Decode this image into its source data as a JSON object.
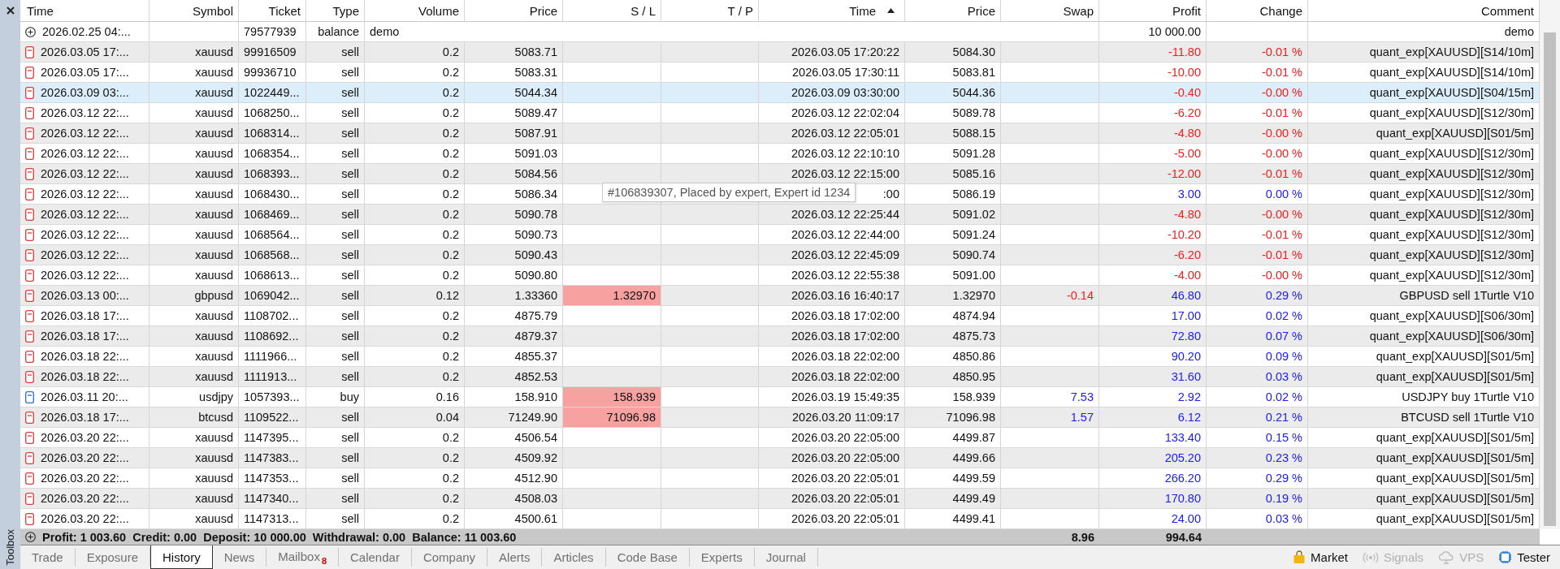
{
  "toolbox": {
    "title": "Toolbox"
  },
  "columns": [
    {
      "label": "Time",
      "sorted": false
    },
    {
      "label": "Symbol",
      "sorted": false
    },
    {
      "label": "Ticket",
      "sorted": false
    },
    {
      "label": "Type",
      "sorted": false
    },
    {
      "label": "Volume",
      "sorted": false
    },
    {
      "label": "Price",
      "sorted": false
    },
    {
      "label": "S / L",
      "sorted": false
    },
    {
      "label": "T / P",
      "sorted": false
    },
    {
      "label": "Time",
      "sorted": true
    },
    {
      "label": "Price",
      "sorted": false
    },
    {
      "label": "Swap",
      "sorted": false
    },
    {
      "label": "Profit",
      "sorted": false
    },
    {
      "label": "Change",
      "sorted": false
    },
    {
      "label": "Comment",
      "sorted": false
    }
  ],
  "balance_row": {
    "time": "2026.02.25 04:...",
    "ticket": "79577939",
    "type": "balance",
    "note": "demo",
    "profit": "10 000.00",
    "comment": "demo"
  },
  "rows": [
    {
      "kind": "sell",
      "selected": false,
      "time": "2026.03.05 17:...",
      "symbol": "xauusd",
      "ticket": "99916509",
      "type": "sell",
      "volume": "0.2",
      "price": "5083.71",
      "sl_hit": false,
      "close_time": "2026.03.05 17:20:22",
      "close_price": "5084.30",
      "profit": "-11.80",
      "change": "-0.01 %",
      "negative": true,
      "comment": "quant_exp[XAUUSD][S14/10m]"
    },
    {
      "kind": "sell",
      "selected": false,
      "time": "2026.03.05 17:...",
      "symbol": "xauusd",
      "ticket": "99936710",
      "type": "sell",
      "volume": "0.2",
      "price": "5083.31",
      "sl_hit": false,
      "close_time": "2026.03.05 17:30:11",
      "close_price": "5083.81",
      "profit": "-10.00",
      "change": "-0.01 %",
      "negative": true,
      "comment": "quant_exp[XAUUSD][S14/10m]"
    },
    {
      "kind": "sell",
      "selected": true,
      "time": "2026.03.09 03:...",
      "symbol": "xauusd",
      "ticket": "1022449...",
      "type": "sell",
      "volume": "0.2",
      "price": "5044.34",
      "sl_hit": false,
      "close_time": "2026.03.09 03:30:00",
      "close_price": "5044.36",
      "profit": "-0.40",
      "change": "-0.00 %",
      "negative": true,
      "comment": "quant_exp[XAUUSD][S04/15m]"
    },
    {
      "kind": "sell",
      "selected": false,
      "time": "2026.03.12 22:...",
      "symbol": "xauusd",
      "ticket": "1068250...",
      "type": "sell",
      "volume": "0.2",
      "price": "5089.47",
      "sl_hit": false,
      "close_time": "2026.03.12 22:02:04",
      "close_price": "5089.78",
      "profit": "-6.20",
      "change": "-0.01 %",
      "negative": true,
      "comment": "quant_exp[XAUUSD][S12/30m]"
    },
    {
      "kind": "sell",
      "selected": false,
      "time": "2026.03.12 22:...",
      "symbol": "xauusd",
      "ticket": "1068314...",
      "type": "sell",
      "volume": "0.2",
      "price": "5087.91",
      "sl_hit": false,
      "close_time": "2026.03.12 22:05:01",
      "close_price": "5088.15",
      "profit": "-4.80",
      "change": "-0.00 %",
      "negative": true,
      "comment": "quant_exp[XAUUSD][S01/5m]"
    },
    {
      "kind": "sell",
      "selected": false,
      "time": "2026.03.12 22:...",
      "symbol": "xauusd",
      "ticket": "1068354...",
      "type": "sell",
      "volume": "0.2",
      "price": "5091.03",
      "sl_hit": false,
      "close_time": "2026.03.12 22:10:10",
      "close_price": "5091.28",
      "profit": "-5.00",
      "change": "-0.00 %",
      "negative": true,
      "comment": "quant_exp[XAUUSD][S12/30m]"
    },
    {
      "kind": "sell",
      "selected": false,
      "time": "2026.03.12 22:...",
      "symbol": "xauusd",
      "ticket": "1068393...",
      "type": "sell",
      "volume": "0.2",
      "price": "5084.56",
      "sl_hit": false,
      "close_time": "2026.03.12 22:15:00",
      "close_price": "5085.16",
      "profit": "-12.00",
      "change": "-0.01 %",
      "negative": true,
      "comment": "quant_exp[XAUUSD][S12/30m]"
    },
    {
      "kind": "sell",
      "selected": false,
      "time": "2026.03.12 22:...",
      "symbol": "xauusd",
      "ticket": "1068430...",
      "type": "sell",
      "volume": "0.2",
      "price": "5086.34",
      "sl_hit": false,
      "close_time": ":00",
      "close_price": "5086.19",
      "profit": "3.00",
      "change": "0.00 %",
      "negative": false,
      "comment": "quant_exp[XAUUSD][S12/30m]"
    },
    {
      "kind": "sell",
      "selected": false,
      "time": "2026.03.12 22:...",
      "symbol": "xauusd",
      "ticket": "1068469...",
      "type": "sell",
      "volume": "0.2",
      "price": "5090.78",
      "sl_hit": false,
      "close_time": "2026.03.12 22:25:44",
      "close_price": "5091.02",
      "profit": "-4.80",
      "change": "-0.00 %",
      "negative": true,
      "comment": "quant_exp[XAUUSD][S12/30m]"
    },
    {
      "kind": "sell",
      "selected": false,
      "time": "2026.03.12 22:...",
      "symbol": "xauusd",
      "ticket": "1068564...",
      "type": "sell",
      "volume": "0.2",
      "price": "5090.73",
      "sl_hit": false,
      "close_time": "2026.03.12 22:44:00",
      "close_price": "5091.24",
      "profit": "-10.20",
      "change": "-0.01 %",
      "negative": true,
      "comment": "quant_exp[XAUUSD][S12/30m]"
    },
    {
      "kind": "sell",
      "selected": false,
      "time": "2026.03.12 22:...",
      "symbol": "xauusd",
      "ticket": "1068568...",
      "type": "sell",
      "volume": "0.2",
      "price": "5090.43",
      "sl_hit": false,
      "close_time": "2026.03.12 22:45:09",
      "close_price": "5090.74",
      "profit": "-6.20",
      "change": "-0.01 %",
      "negative": true,
      "comment": "quant_exp[XAUUSD][S12/30m]"
    },
    {
      "kind": "sell",
      "selected": false,
      "time": "2026.03.12 22:...",
      "symbol": "xauusd",
      "ticket": "1068613...",
      "type": "sell",
      "volume": "0.2",
      "price": "5090.80",
      "sl_hit": false,
      "close_time": "2026.03.12 22:55:38",
      "close_price": "5091.00",
      "profit": "-4.00",
      "change": "-0.00 %",
      "negative": true,
      "comment": "quant_exp[XAUUSD][S12/30m]"
    },
    {
      "kind": "sell",
      "selected": false,
      "time": "2026.03.13 00:...",
      "symbol": "gbpusd",
      "ticket": "1069042...",
      "type": "sell",
      "volume": "0.12",
      "price": "1.33360",
      "sl": "1.32970",
      "sl_hit": true,
      "close_time": "2026.03.16 16:40:17",
      "close_price": "1.32970",
      "swap": "-0.14",
      "swap_negative": true,
      "profit": "46.80",
      "change": "0.29 %",
      "negative": false,
      "comment": "GBPUSD sell 1Turtle V10"
    },
    {
      "kind": "sell",
      "selected": false,
      "time": "2026.03.18 17:...",
      "symbol": "xauusd",
      "ticket": "1108702...",
      "type": "sell",
      "volume": "0.2",
      "price": "4875.79",
      "sl_hit": false,
      "close_time": "2026.03.18 17:02:00",
      "close_price": "4874.94",
      "profit": "17.00",
      "change": "0.02 %",
      "negative": false,
      "comment": "quant_exp[XAUUSD][S06/30m]"
    },
    {
      "kind": "sell",
      "selected": false,
      "time": "2026.03.18 17:...",
      "symbol": "xauusd",
      "ticket": "1108692...",
      "type": "sell",
      "volume": "0.2",
      "price": "4879.37",
      "sl_hit": false,
      "close_time": "2026.03.18 17:02:00",
      "close_price": "4875.73",
      "profit": "72.80",
      "change": "0.07 %",
      "negative": false,
      "comment": "quant_exp[XAUUSD][S06/30m]"
    },
    {
      "kind": "sell",
      "selected": false,
      "time": "2026.03.18 22:...",
      "symbol": "xauusd",
      "ticket": "1111966...",
      "type": "sell",
      "volume": "0.2",
      "price": "4855.37",
      "sl_hit": false,
      "close_time": "2026.03.18 22:02:00",
      "close_price": "4850.86",
      "profit": "90.20",
      "change": "0.09 %",
      "negative": false,
      "comment": "quant_exp[XAUUSD][S01/5m]"
    },
    {
      "kind": "sell",
      "selected": false,
      "time": "2026.03.18 22:...",
      "symbol": "xauusd",
      "ticket": "1111913...",
      "type": "sell",
      "volume": "0.2",
      "price": "4852.53",
      "sl_hit": false,
      "close_time": "2026.03.18 22:02:00",
      "close_price": "4850.95",
      "profit": "31.60",
      "change": "0.03 %",
      "negative": false,
      "comment": "quant_exp[XAUUSD][S01/5m]"
    },
    {
      "kind": "buy",
      "selected": false,
      "time": "2026.03.11 20:...",
      "symbol": "usdjpy",
      "ticket": "1057393...",
      "type": "buy",
      "volume": "0.16",
      "price": "158.910",
      "sl": "158.939",
      "sl_hit": true,
      "close_time": "2026.03.19 15:49:35",
      "close_price": "158.939",
      "swap": "7.53",
      "swap_negative": false,
      "profit": "2.92",
      "change": "0.02 %",
      "negative": false,
      "comment": "USDJPY buy 1Turtle V10"
    },
    {
      "kind": "sell",
      "selected": false,
      "time": "2026.03.18 17:...",
      "symbol": "btcusd",
      "ticket": "1109522...",
      "type": "sell",
      "volume": "0.04",
      "price": "71249.90",
      "sl": "71096.98",
      "sl_hit": true,
      "close_time": "2026.03.20 11:09:17",
      "close_price": "71096.98",
      "swap": "1.57",
      "swap_negative": false,
      "profit": "6.12",
      "change": "0.21 %",
      "negative": false,
      "comment": "BTCUSD sell 1Turtle V10"
    },
    {
      "kind": "sell",
      "selected": false,
      "time": "2026.03.20 22:...",
      "symbol": "xauusd",
      "ticket": "1147395...",
      "type": "sell",
      "volume": "0.2",
      "price": "4506.54",
      "sl_hit": false,
      "close_time": "2026.03.20 22:05:00",
      "close_price": "4499.87",
      "profit": "133.40",
      "change": "0.15 %",
      "negative": false,
      "comment": "quant_exp[XAUUSD][S01/5m]"
    },
    {
      "kind": "sell",
      "selected": false,
      "time": "2026.03.20 22:...",
      "symbol": "xauusd",
      "ticket": "1147383...",
      "type": "sell",
      "volume": "0.2",
      "price": "4509.92",
      "sl_hit": false,
      "close_time": "2026.03.20 22:05:00",
      "close_price": "4499.66",
      "profit": "205.20",
      "change": "0.23 %",
      "negative": false,
      "comment": "quant_exp[XAUUSD][S01/5m]"
    },
    {
      "kind": "sell",
      "selected": false,
      "time": "2026.03.20 22:...",
      "symbol": "xauusd",
      "ticket": "1147353...",
      "type": "sell",
      "volume": "0.2",
      "price": "4512.90",
      "sl_hit": false,
      "close_time": "2026.03.20 22:05:01",
      "close_price": "4499.59",
      "profit": "266.20",
      "change": "0.29 %",
      "negative": false,
      "comment": "quant_exp[XAUUSD][S01/5m]"
    },
    {
      "kind": "sell",
      "selected": false,
      "time": "2026.03.20 22:...",
      "symbol": "xauusd",
      "ticket": "1147340...",
      "type": "sell",
      "volume": "0.2",
      "price": "4508.03",
      "sl_hit": false,
      "close_time": "2026.03.20 22:05:01",
      "close_price": "4499.49",
      "profit": "170.80",
      "change": "0.19 %",
      "negative": false,
      "comment": "quant_exp[XAUUSD][S01/5m]"
    },
    {
      "kind": "sell",
      "selected": false,
      "time": "2026.03.20 22:...",
      "symbol": "xauusd",
      "ticket": "1147313...",
      "type": "sell",
      "volume": "0.2",
      "price": "4500.61",
      "sl_hit": false,
      "close_time": "2026.03.20 22:05:01",
      "close_price": "4499.41",
      "profit": "24.00",
      "change": "0.03 %",
      "negative": false,
      "comment": "quant_exp[XAUUSD][S01/5m]"
    }
  ],
  "tooltip": "#106839307, Placed by expert, Expert id 1234",
  "summary": {
    "text": "Profit: 1 003.60  Credit: 0.00  Deposit: 10 000.00  Withdrawal: 0.00  Balance: 11 003.60",
    "swap": "8.96",
    "profit": "994.64"
  },
  "tabs": [
    {
      "label": "Trade",
      "selected": false
    },
    {
      "label": "Exposure",
      "selected": false
    },
    {
      "label": "History",
      "selected": true
    },
    {
      "label": "News",
      "selected": false
    },
    {
      "label": "Mailbox",
      "badge": "8",
      "selected": false
    },
    {
      "label": "Calendar",
      "selected": false
    },
    {
      "label": "Company",
      "selected": false
    },
    {
      "label": "Alerts",
      "selected": false
    },
    {
      "label": "Articles",
      "selected": false
    },
    {
      "label": "Code Base",
      "selected": false
    },
    {
      "label": "Experts",
      "selected": false
    },
    {
      "label": "Journal",
      "selected": false
    }
  ],
  "tools": [
    {
      "kind": "market",
      "label": "Market",
      "disabled": false
    },
    {
      "kind": "signals",
      "label": "Signals",
      "disabled": true
    },
    {
      "kind": "vps",
      "label": "VPS",
      "disabled": true
    },
    {
      "kind": "tester",
      "label": "Tester",
      "disabled": false
    }
  ]
}
